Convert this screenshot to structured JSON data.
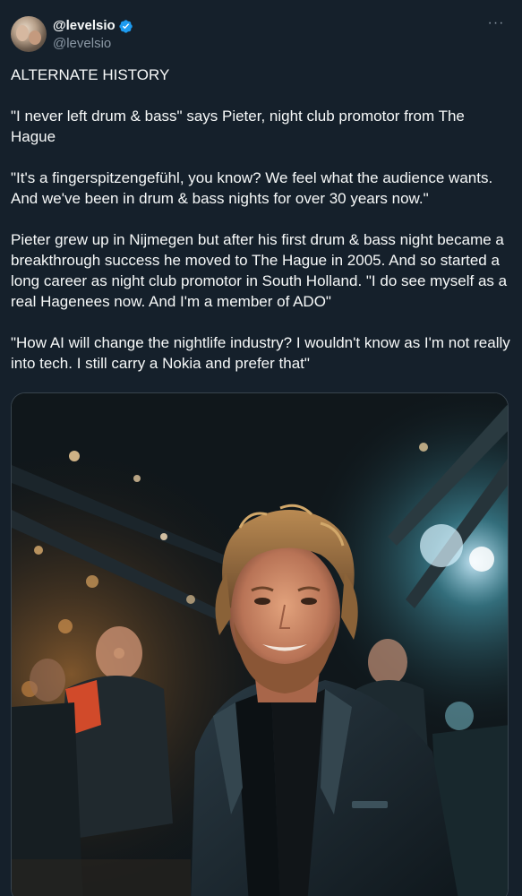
{
  "author": {
    "display_name": "@levelsio",
    "handle": "@levelsio",
    "verified": true,
    "avatar_icon": "avatar-photo"
  },
  "more_label": "···",
  "tweet": {
    "paragraphs": [
      "ALTERNATE HISTORY",
      "\"I never left drum & bass\" says Pieter, night club promotor from The Hague",
      "\"It's a fingerspitzengefühl, you know? We feel what the audience wants. And we've been in drum & bass nights for over 30 years now.\"",
      "Pieter grew up in Nijmegen but after his first drum & bass night became a breakthrough success he moved to The Hague in 2005. And so started a long career as night club promotor in South Holland. \"I do see myself as a real Hagenees now. And I'm a member of ADO\"",
      "\"How AI will change the nightlife industry? I wouldn't know as I'm not really into tech. I still carry a Nokia and prefer that\""
    ]
  },
  "colors": {
    "background": "#15202b",
    "text": "#f7f9f9",
    "secondary": "#8b98a5",
    "verified_blue": "#1d9bf0"
  }
}
